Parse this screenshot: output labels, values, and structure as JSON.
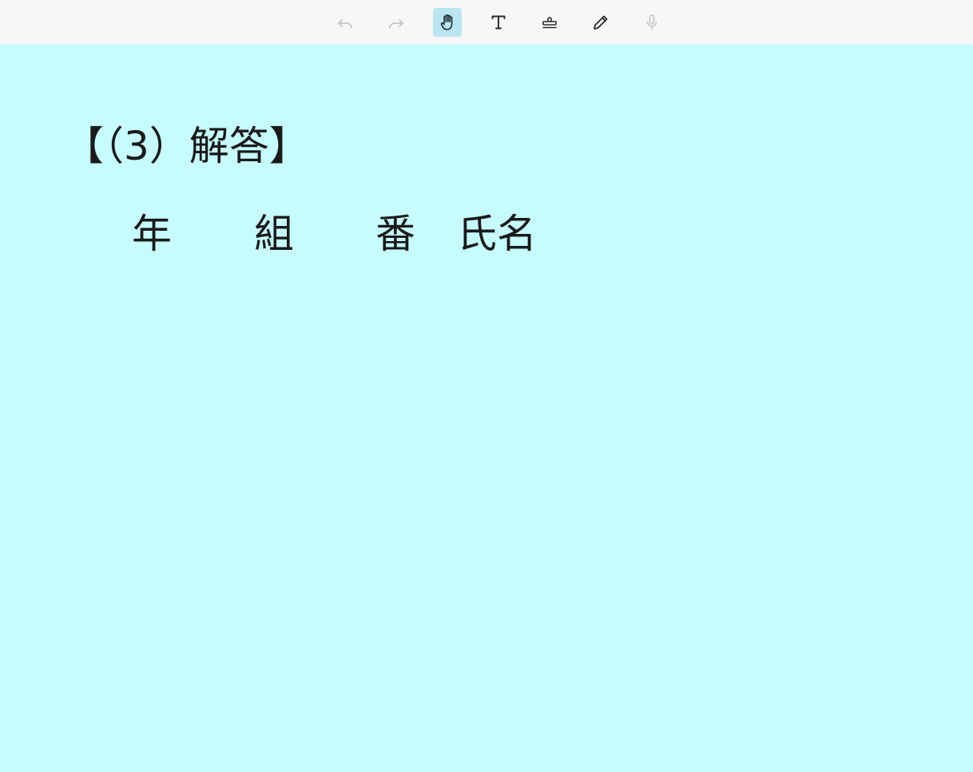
{
  "toolbar": {
    "tools": [
      {
        "id": "undo",
        "icon": "undo-icon",
        "enabled": false
      },
      {
        "id": "redo",
        "icon": "redo-icon",
        "enabled": false
      },
      {
        "id": "hand",
        "icon": "hand-icon",
        "active": true
      },
      {
        "id": "text",
        "icon": "text-icon",
        "enabled": true
      },
      {
        "id": "stamp",
        "icon": "stamp-icon",
        "enabled": true
      },
      {
        "id": "pen",
        "icon": "pencil-icon",
        "enabled": true
      },
      {
        "id": "mic",
        "icon": "microphone-icon",
        "enabled": false
      }
    ]
  },
  "sheet": {
    "heading": "【（3）解答】",
    "fields": {
      "year": "年",
      "class": "組",
      "number": "番",
      "name": "氏名"
    }
  },
  "colors": {
    "canvas_background": "#c6fcfd",
    "toolbar_background": "#f7f7f9",
    "active_tool_background": "#b9e6f0"
  }
}
